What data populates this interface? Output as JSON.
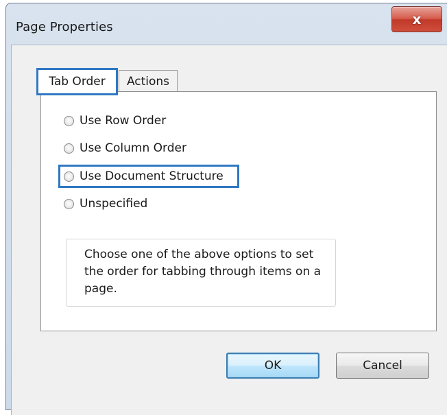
{
  "window": {
    "title": "Page Properties",
    "close_glyph": "x"
  },
  "tabs": [
    {
      "label": "Tab Order",
      "active": true
    },
    {
      "label": "Actions",
      "active": false
    }
  ],
  "tab_order": {
    "options": [
      {
        "label": "Use Row Order",
        "selected": false
      },
      {
        "label": "Use Column Order",
        "selected": false
      },
      {
        "label": "Use Document Structure",
        "selected": false
      },
      {
        "label": "Unspecified",
        "selected": false
      }
    ],
    "help_text": "Choose one of the above options to set the order for tabbing through items on a page."
  },
  "buttons": {
    "ok": "OK",
    "cancel": "Cancel"
  },
  "colors": {
    "highlight": "#2f78c4",
    "close_button": "#c1392a",
    "window_frame": "#cddaea",
    "dialog_background": "#f0f0f0"
  },
  "icons": {
    "close": "close-icon",
    "radio": "radio-button-icon"
  }
}
